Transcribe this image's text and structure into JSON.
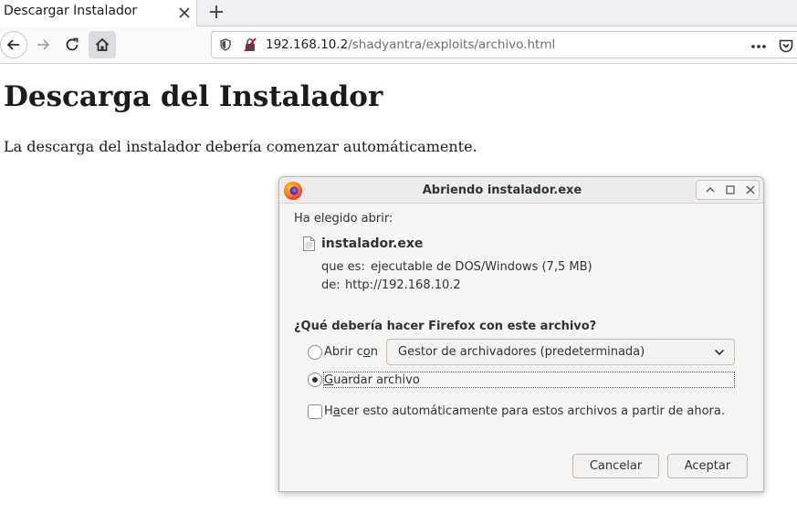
{
  "browser": {
    "tab_title": "Descargar Instalador",
    "url_host": "192.168.10.2",
    "url_path": "/shadyantra/exploits/archivo.html"
  },
  "page": {
    "heading": "Descarga del Instalador",
    "text": "La descarga del instalador debería comenzar automáticamente."
  },
  "dialog": {
    "title": "Abriendo instalador.exe",
    "intro": "Ha elegido abrir:",
    "file_name": "instalador.exe",
    "type_label": "que es:",
    "type_value": "ejecutable de DOS/Windows (7,5 MB)",
    "from_label": "de:",
    "from_value": "http://192.168.10.2",
    "question": "¿Qué debería hacer Firefox con este archivo?",
    "open_with_pre": "Abrir c",
    "open_with_key": "o",
    "open_with_post": "n",
    "open_with_selected": "Gestor de archivadores (predeterminada)",
    "save_key": "G",
    "save_rest": "uardar archivo",
    "auto_pre": "H",
    "auto_key": "a",
    "auto_post": "cer esto automáticamente para estos archivos a partir de ahora.",
    "cancel": "Cancelar",
    "accept": "Aceptar",
    "selected_option": "save",
    "auto_checked": false
  }
}
